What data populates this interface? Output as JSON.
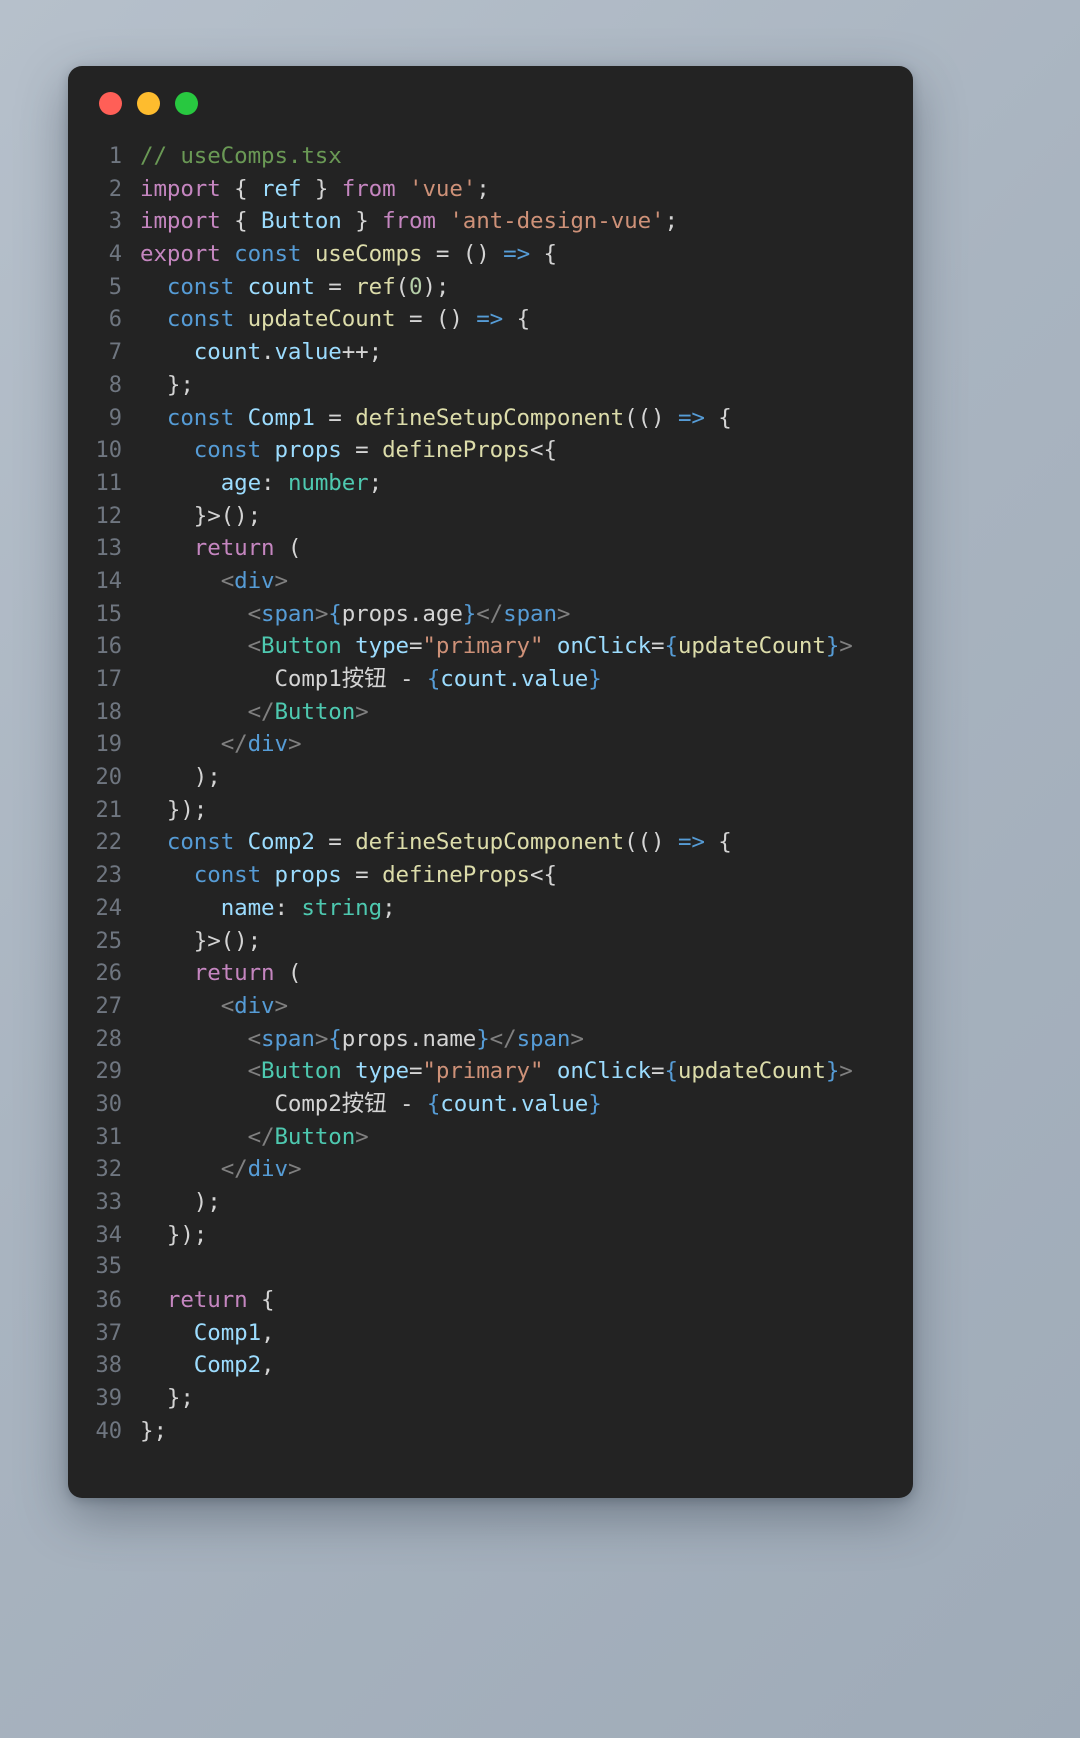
{
  "window": {
    "title": "useComps.tsx",
    "traffic_lights": [
      {
        "name": "close-dot",
        "color": "#FF5F57"
      },
      {
        "name": "minimize-dot",
        "color": "#FEBC2E"
      },
      {
        "name": "maximize-dot",
        "color": "#28C840"
      }
    ],
    "background_color": "#232323",
    "page_background": "#aab5c1"
  },
  "editor": {
    "language": "tsx",
    "line_count": 40,
    "gutter_color": "#6f7680",
    "theme_colors": {
      "comment": "#6A9955",
      "keyword": "#C586C0",
      "keyword_declaration": "#569CD6",
      "variable": "#9CDCFE",
      "function": "#DCDCAA",
      "string": "#CE9178",
      "number": "#B5CEA8",
      "type": "#4EC9B0",
      "tag": "#569CD6",
      "component_tag": "#4EC9B0",
      "bracket": "#808080",
      "plain": "#D4D4D4"
    },
    "line_numbers": [
      "1",
      "2",
      "3",
      "4",
      "5",
      "6",
      "7",
      "8",
      "9",
      "10",
      "11",
      "12",
      "13",
      "14",
      "15",
      "16",
      "17",
      "18",
      "19",
      "20",
      "21",
      "22",
      "23",
      "24",
      "25",
      "26",
      "27",
      "28",
      "29",
      "30",
      "31",
      "32",
      "33",
      "34",
      "35",
      "36",
      "37",
      "38",
      "39",
      "40"
    ],
    "lines": [
      "// useComps.tsx",
      "import { ref } from 'vue';",
      "import { Button } from 'ant-design-vue';",
      "export const useComps = () => {",
      "  const count = ref(0);",
      "  const updateCount = () => {",
      "    count.value++;",
      "  };",
      "  const Comp1 = defineSetupComponent(() => {",
      "    const props = defineProps<{",
      "      age: number;",
      "    }>();",
      "    return (",
      "      <div>",
      "        <span>{props.age}</span>",
      "        <Button type=\"primary\" onClick={updateCount}>",
      "          Comp1按钮 - {count.value}",
      "        </Button>",
      "      </div>",
      "    );",
      "  });",
      "  const Comp2 = defineSetupComponent(() => {",
      "    const props = defineProps<{",
      "      name: string;",
      "    }>();",
      "    return (",
      "      <div>",
      "        <span>{props.name}</span>",
      "        <Button type=\"primary\" onClick={updateCount}>",
      "          Comp2按钮 - {count.value}",
      "        </Button>",
      "      </div>",
      "    );",
      "  });",
      "",
      "  return {",
      "    Comp1,",
      "    Comp2,",
      "  };",
      "};"
    ],
    "tokens": [
      [
        [
          "// useComps.tsx",
          "t-com"
        ]
      ],
      [
        [
          "import",
          "t-kw"
        ],
        [
          " ",
          "t-pln"
        ],
        [
          "{",
          "t-pln"
        ],
        [
          " ",
          "t-pln"
        ],
        [
          "ref",
          "t-var"
        ],
        [
          " ",
          "t-pln"
        ],
        [
          "}",
          "t-pln"
        ],
        [
          " ",
          "t-pln"
        ],
        [
          "from",
          "t-kw"
        ],
        [
          " ",
          "t-pln"
        ],
        [
          "'vue'",
          "t-str"
        ],
        [
          ";",
          "t-pln"
        ]
      ],
      [
        [
          "import",
          "t-kw"
        ],
        [
          " ",
          "t-pln"
        ],
        [
          "{",
          "t-pln"
        ],
        [
          " ",
          "t-pln"
        ],
        [
          "Button",
          "t-var"
        ],
        [
          " ",
          "t-pln"
        ],
        [
          "}",
          "t-pln"
        ],
        [
          " ",
          "t-pln"
        ],
        [
          "from",
          "t-kw"
        ],
        [
          " ",
          "t-pln"
        ],
        [
          "'ant-design-vue'",
          "t-str"
        ],
        [
          ";",
          "t-pln"
        ]
      ],
      [
        [
          "export",
          "t-kw"
        ],
        [
          " ",
          "t-pln"
        ],
        [
          "const",
          "t-kw2"
        ],
        [
          " ",
          "t-pln"
        ],
        [
          "useComps",
          "t-fn"
        ],
        [
          " ",
          "t-pln"
        ],
        [
          "=",
          "t-op"
        ],
        [
          " ",
          "t-pln"
        ],
        [
          "()",
          "t-pln"
        ],
        [
          " ",
          "t-pln"
        ],
        [
          "=>",
          "t-kw2"
        ],
        [
          " ",
          "t-pln"
        ],
        [
          "{",
          "t-pln"
        ]
      ],
      [
        [
          "  ",
          "t-pln"
        ],
        [
          "const",
          "t-kw2"
        ],
        [
          " ",
          "t-pln"
        ],
        [
          "count",
          "t-var"
        ],
        [
          " ",
          "t-pln"
        ],
        [
          "=",
          "t-op"
        ],
        [
          " ",
          "t-pln"
        ],
        [
          "ref",
          "t-fn"
        ],
        [
          "(",
          "t-pln"
        ],
        [
          "0",
          "t-num"
        ],
        [
          ");",
          "t-pln"
        ]
      ],
      [
        [
          "  ",
          "t-pln"
        ],
        [
          "const",
          "t-kw2"
        ],
        [
          " ",
          "t-pln"
        ],
        [
          "updateCount",
          "t-fn"
        ],
        [
          " ",
          "t-pln"
        ],
        [
          "=",
          "t-op"
        ],
        [
          " ",
          "t-pln"
        ],
        [
          "()",
          "t-pln"
        ],
        [
          " ",
          "t-pln"
        ],
        [
          "=>",
          "t-kw2"
        ],
        [
          " ",
          "t-pln"
        ],
        [
          "{",
          "t-pln"
        ]
      ],
      [
        [
          "    ",
          "t-pln"
        ],
        [
          "count",
          "t-var"
        ],
        [
          ".",
          "t-pln"
        ],
        [
          "value",
          "t-var"
        ],
        [
          "++;",
          "t-pln"
        ]
      ],
      [
        [
          "  };",
          "t-pln"
        ]
      ],
      [
        [
          "  ",
          "t-pln"
        ],
        [
          "const",
          "t-kw2"
        ],
        [
          " ",
          "t-pln"
        ],
        [
          "Comp1",
          "t-var"
        ],
        [
          " ",
          "t-pln"
        ],
        [
          "=",
          "t-op"
        ],
        [
          " ",
          "t-pln"
        ],
        [
          "defineSetupComponent",
          "t-fn"
        ],
        [
          "((",
          "t-pln"
        ],
        [
          ")",
          "t-pln"
        ],
        [
          " ",
          "t-pln"
        ],
        [
          "=>",
          "t-kw2"
        ],
        [
          " ",
          "t-pln"
        ],
        [
          "{",
          "t-pln"
        ]
      ],
      [
        [
          "    ",
          "t-pln"
        ],
        [
          "const",
          "t-kw2"
        ],
        [
          " ",
          "t-pln"
        ],
        [
          "props",
          "t-var"
        ],
        [
          " ",
          "t-pln"
        ],
        [
          "=",
          "t-op"
        ],
        [
          " ",
          "t-pln"
        ],
        [
          "defineProps",
          "t-fn"
        ],
        [
          "<{",
          "t-pln"
        ]
      ],
      [
        [
          "      ",
          "t-pln"
        ],
        [
          "age",
          "t-var"
        ],
        [
          ": ",
          "t-pln"
        ],
        [
          "number",
          "t-type"
        ],
        [
          ";",
          "t-pln"
        ]
      ],
      [
        [
          "    }>();",
          "t-pln"
        ]
      ],
      [
        [
          "    ",
          "t-pln"
        ],
        [
          "return",
          "t-kw"
        ],
        [
          " (",
          "t-pln"
        ]
      ],
      [
        [
          "      ",
          "t-pln"
        ],
        [
          "<",
          "t-brk"
        ],
        [
          "div",
          "t-tag"
        ],
        [
          ">",
          "t-brk"
        ]
      ],
      [
        [
          "        ",
          "t-pln"
        ],
        [
          "<",
          "t-brk"
        ],
        [
          "span",
          "t-tag"
        ],
        [
          ">",
          "t-brk"
        ],
        [
          "{",
          "t-brace"
        ],
        [
          "props",
          "t-pln"
        ],
        [
          ".",
          "t-pln"
        ],
        [
          "age",
          "t-pln"
        ],
        [
          "}",
          "t-brace"
        ],
        [
          "</",
          "t-brk"
        ],
        [
          "span",
          "t-tag"
        ],
        [
          ">",
          "t-brk"
        ]
      ],
      [
        [
          "        ",
          "t-pln"
        ],
        [
          "<",
          "t-brk"
        ],
        [
          "Button",
          "t-comp"
        ],
        [
          " ",
          "t-pln"
        ],
        [
          "type",
          "t-var"
        ],
        [
          "=",
          "t-op"
        ],
        [
          "\"primary\"",
          "t-str"
        ],
        [
          " ",
          "t-pln"
        ],
        [
          "onClick",
          "t-var"
        ],
        [
          "=",
          "t-op"
        ],
        [
          "{",
          "t-brace"
        ],
        [
          "updateCount",
          "t-fn"
        ],
        [
          "}",
          "t-brace"
        ],
        [
          ">",
          "t-brk"
        ]
      ],
      [
        [
          "          ",
          "t-pln"
        ],
        [
          "Comp1按钮 - ",
          "t-pln"
        ],
        [
          "{",
          "t-brace"
        ],
        [
          "count.value",
          "t-var"
        ],
        [
          "}",
          "t-brace"
        ]
      ],
      [
        [
          "        ",
          "t-pln"
        ],
        [
          "</",
          "t-brk"
        ],
        [
          "Button",
          "t-comp"
        ],
        [
          ">",
          "t-brk"
        ]
      ],
      [
        [
          "      ",
          "t-pln"
        ],
        [
          "</",
          "t-brk"
        ],
        [
          "div",
          "t-tag"
        ],
        [
          ">",
          "t-brk"
        ]
      ],
      [
        [
          "    );",
          "t-pln"
        ]
      ],
      [
        [
          "  });",
          "t-pln"
        ]
      ],
      [
        [
          "  ",
          "t-pln"
        ],
        [
          "const",
          "t-kw2"
        ],
        [
          " ",
          "t-pln"
        ],
        [
          "Comp2",
          "t-var"
        ],
        [
          " ",
          "t-pln"
        ],
        [
          "=",
          "t-op"
        ],
        [
          " ",
          "t-pln"
        ],
        [
          "defineSetupComponent",
          "t-fn"
        ],
        [
          "((",
          "t-pln"
        ],
        [
          ")",
          "t-pln"
        ],
        [
          " ",
          "t-pln"
        ],
        [
          "=>",
          "t-kw2"
        ],
        [
          " ",
          "t-pln"
        ],
        [
          "{",
          "t-pln"
        ]
      ],
      [
        [
          "    ",
          "t-pln"
        ],
        [
          "const",
          "t-kw2"
        ],
        [
          " ",
          "t-pln"
        ],
        [
          "props",
          "t-var"
        ],
        [
          " ",
          "t-pln"
        ],
        [
          "=",
          "t-op"
        ],
        [
          " ",
          "t-pln"
        ],
        [
          "defineProps",
          "t-fn"
        ],
        [
          "<{",
          "t-pln"
        ]
      ],
      [
        [
          "      ",
          "t-pln"
        ],
        [
          "name",
          "t-var"
        ],
        [
          ": ",
          "t-pln"
        ],
        [
          "string",
          "t-type"
        ],
        [
          ";",
          "t-pln"
        ]
      ],
      [
        [
          "    }>();",
          "t-pln"
        ]
      ],
      [
        [
          "    ",
          "t-pln"
        ],
        [
          "return",
          "t-kw"
        ],
        [
          " (",
          "t-pln"
        ]
      ],
      [
        [
          "      ",
          "t-pln"
        ],
        [
          "<",
          "t-brk"
        ],
        [
          "div",
          "t-tag"
        ],
        [
          ">",
          "t-brk"
        ]
      ],
      [
        [
          "        ",
          "t-pln"
        ],
        [
          "<",
          "t-brk"
        ],
        [
          "span",
          "t-tag"
        ],
        [
          ">",
          "t-brk"
        ],
        [
          "{",
          "t-brace"
        ],
        [
          "props",
          "t-pln"
        ],
        [
          ".",
          "t-pln"
        ],
        [
          "name",
          "t-pln"
        ],
        [
          "}",
          "t-brace"
        ],
        [
          "</",
          "t-brk"
        ],
        [
          "span",
          "t-tag"
        ],
        [
          ">",
          "t-brk"
        ]
      ],
      [
        [
          "        ",
          "t-pln"
        ],
        [
          "<",
          "t-brk"
        ],
        [
          "Button",
          "t-comp"
        ],
        [
          " ",
          "t-pln"
        ],
        [
          "type",
          "t-var"
        ],
        [
          "=",
          "t-op"
        ],
        [
          "\"primary\"",
          "t-str"
        ],
        [
          " ",
          "t-pln"
        ],
        [
          "onClick",
          "t-var"
        ],
        [
          "=",
          "t-op"
        ],
        [
          "{",
          "t-brace"
        ],
        [
          "updateCount",
          "t-fn"
        ],
        [
          "}",
          "t-brace"
        ],
        [
          ">",
          "t-brk"
        ]
      ],
      [
        [
          "          ",
          "t-pln"
        ],
        [
          "Comp2按钮 - ",
          "t-pln"
        ],
        [
          "{",
          "t-brace"
        ],
        [
          "count.value",
          "t-var"
        ],
        [
          "}",
          "t-brace"
        ]
      ],
      [
        [
          "        ",
          "t-pln"
        ],
        [
          "</",
          "t-brk"
        ],
        [
          "Button",
          "t-comp"
        ],
        [
          ">",
          "t-brk"
        ]
      ],
      [
        [
          "      ",
          "t-pln"
        ],
        [
          "</",
          "t-brk"
        ],
        [
          "div",
          "t-tag"
        ],
        [
          ">",
          "t-brk"
        ]
      ],
      [
        [
          "    );",
          "t-pln"
        ]
      ],
      [
        [
          "  });",
          "t-pln"
        ]
      ],
      [
        [
          "",
          "t-pln"
        ]
      ],
      [
        [
          "  ",
          "t-pln"
        ],
        [
          "return",
          "t-kw"
        ],
        [
          " {",
          "t-pln"
        ]
      ],
      [
        [
          "    ",
          "t-pln"
        ],
        [
          "Comp1",
          "t-var"
        ],
        [
          ",",
          "t-pln"
        ]
      ],
      [
        [
          "    ",
          "t-pln"
        ],
        [
          "Comp2",
          "t-var"
        ],
        [
          ",",
          "t-pln"
        ]
      ],
      [
        [
          "  };",
          "t-pln"
        ]
      ],
      [
        [
          "};",
          "t-pln"
        ]
      ]
    ]
  }
}
